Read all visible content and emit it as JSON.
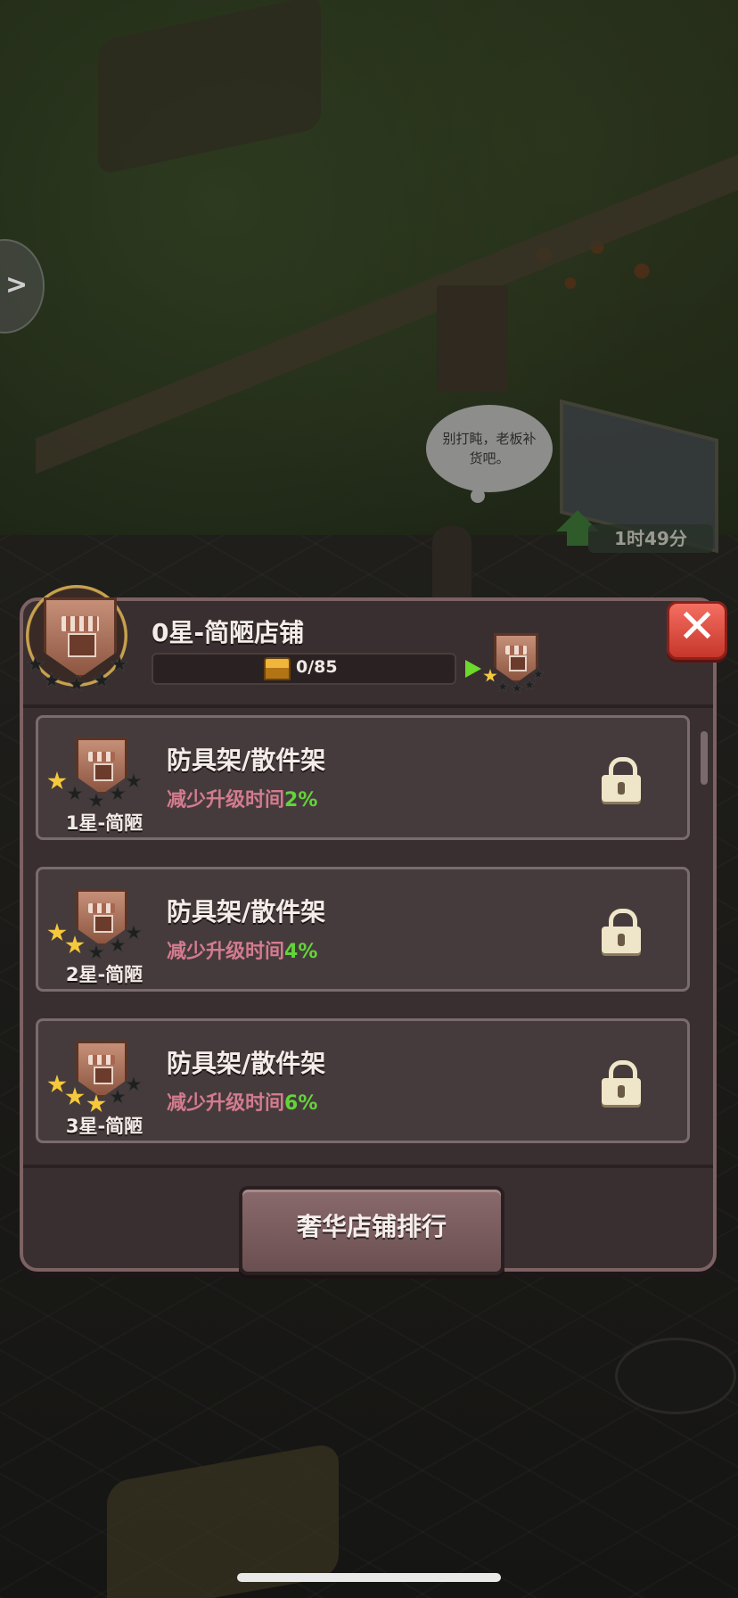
{
  "background": {
    "speech_bubble": "别打盹，老板补货吧。",
    "upgrade_timer": "1时49分"
  },
  "dialog": {
    "title": "0星-简陋店铺",
    "progress": {
      "text": "0/85",
      "current": 0,
      "max": 85
    },
    "current_stars": 0,
    "next_stars": 1,
    "items": [
      {
        "tier_label": "1星-简陋",
        "stars": 1,
        "name": "防具架/散件架",
        "effect_text": "减少升级时间",
        "effect_value": "2%",
        "locked": true
      },
      {
        "tier_label": "2星-简陋",
        "stars": 2,
        "name": "防具架/散件架",
        "effect_text": "减少升级时间",
        "effect_value": "4%",
        "locked": true
      },
      {
        "tier_label": "3星-简陋",
        "stars": 3,
        "name": "防具架/散件架",
        "effect_text": "减少升级时间",
        "effect_value": "6%",
        "locked": true
      }
    ],
    "rank_button": "奢华店铺排行"
  },
  "colors": {
    "panel": "#3a2f30",
    "effect_text": "#d37b8f",
    "effect_value": "#62d43a",
    "close_button": "#e24a3d",
    "star_full": "#f6c93c"
  },
  "icons": [
    "chevron-right-icon",
    "chest-icon",
    "play-arrow-icon",
    "close-icon",
    "shop-badge-icon",
    "star-icon",
    "lock-icon"
  ]
}
